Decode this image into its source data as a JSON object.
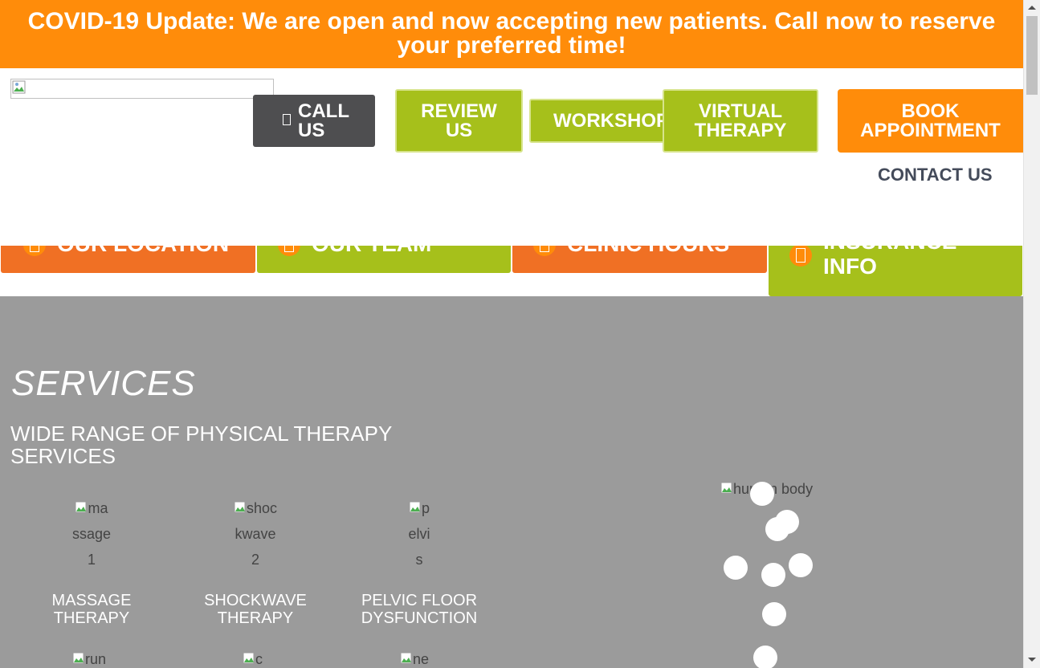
{
  "banner": {
    "text": "COVID-19 Update: We are open and now accepting new patients. Call now to reserve your preferred time!"
  },
  "header": {
    "logo_icon": "broken-image-icon",
    "buttons": {
      "call": "CALL US",
      "review": "REVIEW US",
      "workshop": "WORKSHOP",
      "virtual": "VIRTUAL THERAPY",
      "book": "BOOK APPOINTMENT"
    },
    "nav": {
      "contact": "CONTACT US"
    }
  },
  "quick_tabs": {
    "location": "OUR LOCATION",
    "team": "OUR TEAM",
    "hours": "CLINIC HOURS",
    "insurance_1": "INSURANCE",
    "insurance_2": "INFO"
  },
  "services": {
    "title": "SERVICES",
    "subtitle": "WIDE RANGE OF PHYSICAL THERAPY SERVICES",
    "items": [
      {
        "alt_1": "ma",
        "alt_2": "ssage",
        "alt_3": "1",
        "name_1": "MASSAGE",
        "name_2": "THERAPY"
      },
      {
        "alt_1": "shoc",
        "alt_2": "kwave",
        "alt_3": "2",
        "name_1": "SHOCKWAVE",
        "name_2": "THERAPY"
      },
      {
        "alt_1": "p",
        "alt_2": "elvi",
        "alt_3": "s",
        "name_1": "PELVIC FLOOR",
        "name_2": "DYSFUNCTION"
      }
    ],
    "row2": [
      {
        "alt": "run"
      },
      {
        "alt": "c"
      },
      {
        "alt": "ne"
      }
    ],
    "body_image_alt": "human body"
  },
  "colors": {
    "orange": "#ff8c0a",
    "green": "#a6c01b",
    "dark": "#4e4e50",
    "section_bg": "#9b9b9b",
    "tab_orange": "#f07024"
  }
}
